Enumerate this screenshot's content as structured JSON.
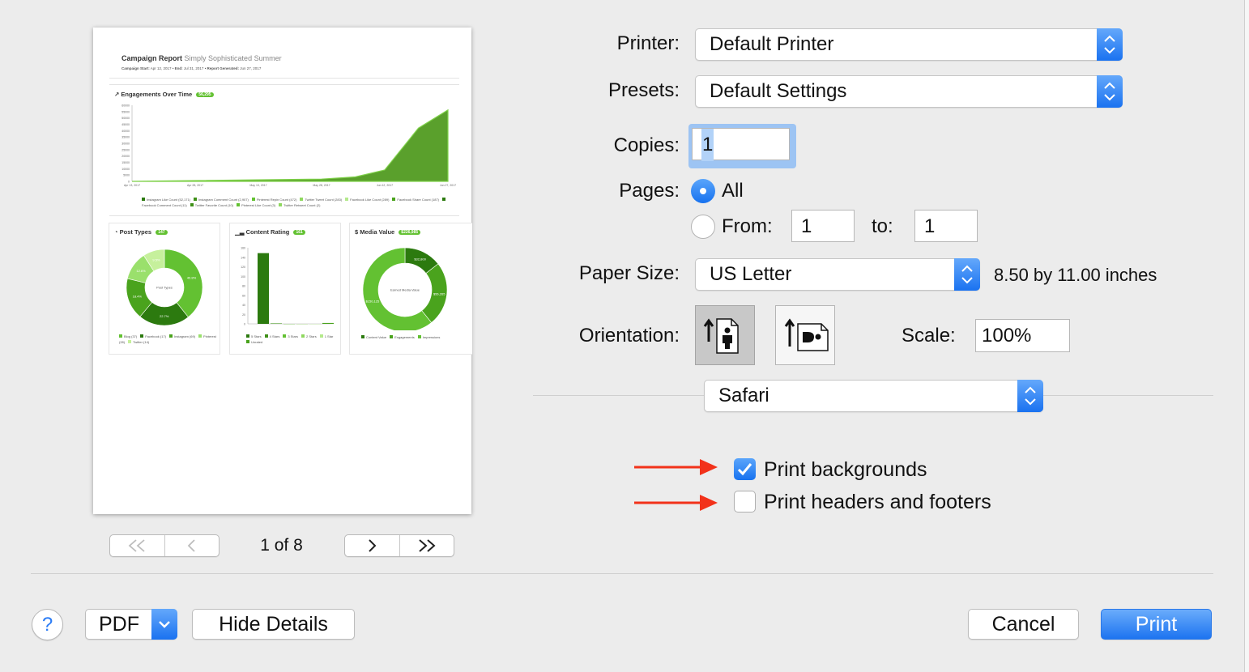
{
  "preview": {
    "report_title": "Campaign Report",
    "report_subtitle": "Simply Sophisticated Summer",
    "meta_start_label": "Campaign Start:",
    "meta_start": "Apr 12, 2017",
    "meta_end_label": "End:",
    "meta_end": "Jul 31, 2017",
    "meta_generated_label": "Report Generated:",
    "meta_generated": "Jun 27, 2017",
    "engagements_title": "Engagements Over Time",
    "engagements_badge": "56,295",
    "engagements_chart": {
      "type": "area",
      "x_ticks": [
        "Apr 13, 2017",
        "Apr 28, 2017",
        "May 13, 2017",
        "May 28, 2017",
        "Jun 12, 2017",
        "Jun 27, 2017"
      ],
      "y_ticks": [
        "60000",
        "55000",
        "50000",
        "45000",
        "40000",
        "35000",
        "30000",
        "25000",
        "20000",
        "15000",
        "10000",
        "5000",
        "0"
      ],
      "x": [
        "Apr 13",
        "May 28",
        "Jun 5",
        "Jun 12",
        "Jun 20",
        "Jun 27"
      ],
      "values": [
        0,
        1800,
        3500,
        9000,
        42000,
        56295
      ],
      "ylim": [
        0,
        60000
      ],
      "color": "#5aa02c",
      "legend": [
        "Instagram Like Count (52,171)",
        "Instagram Comment Count (2,907)",
        "Pinterest Repin Count (472)",
        "Twitter Tweet Count (283)",
        "Facebook Like Count (289)",
        "Facebook Share Count (187)",
        "Facebook Comment Count (11)",
        "Twitter Favorite Count (10)",
        "Pinterest Like Count (3)",
        "Twitter Retweet Count (2)"
      ]
    },
    "post_types": {
      "title": "Post Types",
      "badge": "147",
      "center_label": "Post Types",
      "slice_labels": [
        "40.8%",
        "22.7%",
        "18.4%",
        "12.6%",
        "9.5%"
      ],
      "values": [
        40.8,
        22.7,
        18.4,
        12.6,
        9.5
      ],
      "colors": [
        "#63c132",
        "#2c7a0f",
        "#4aa31d",
        "#9ae06c",
        "#c6f09c"
      ],
      "legend": [
        "Blog (37)",
        "Facebook (17)",
        "Instagram (69)",
        "Pinterest (28)",
        "Twitter (14)"
      ]
    },
    "content_rating": {
      "title": "Content Rating",
      "badge": "161",
      "type": "bar",
      "categories": [
        "5 Stars",
        "4 Stars",
        "3 Stars",
        "2 Stars",
        "1 Star",
        "Unrated"
      ],
      "values": [
        158,
        1,
        0,
        0,
        0,
        2
      ],
      "y_ticks": [
        "160",
        "140",
        "120",
        "100",
        "80",
        "60",
        "40",
        "20",
        "0"
      ],
      "ylim": [
        0,
        170
      ],
      "legend": [
        "5 Stars",
        "4 Stars",
        "3 Stars",
        "2 Stars",
        "1 Star",
        "Unrated"
      ]
    },
    "media_value": {
      "title": "Media Value",
      "badge": "$226,985",
      "center_label": "Earned Media Value",
      "slice_labels": [
        "$32,800",
        "$56,265",
        "$150,125"
      ],
      "values": [
        14.4,
        24.8,
        60.8
      ],
      "colors": [
        "#2c7a0f",
        "#4aa31d",
        "#63c132"
      ],
      "legend": [
        "Content Value",
        "Engagements",
        "Impressions"
      ]
    }
  },
  "pager": {
    "first_icon": "double-chevron-left-icon",
    "prev_icon": "chevron-left-icon",
    "next_icon": "chevron-right-icon",
    "last_icon": "double-chevron-right-icon",
    "indicator": "1 of 8"
  },
  "form": {
    "printer_label": "Printer:",
    "printer_value": "Default Printer",
    "presets_label": "Presets:",
    "presets_value": "Default Settings",
    "copies_label": "Copies:",
    "copies_value": "1",
    "pages_label": "Pages:",
    "pages_all": "All",
    "pages_from": "From:",
    "pages_from_value": "1",
    "pages_to": "to:",
    "pages_to_value": "1",
    "paper_size_label": "Paper Size:",
    "paper_size_value": "US Letter",
    "paper_size_dims": "8.50 by 11.00 inches",
    "orientation_label": "Orientation:",
    "scale_label": "Scale:",
    "scale_value": "100%",
    "section_value": "Safari",
    "print_backgrounds": "Print backgrounds",
    "print_backgrounds_checked": true,
    "print_headers_footers": "Print headers and footers",
    "print_headers_footers_checked": false,
    "accent": "#1a72f0",
    "arrow_color": "#f2321a"
  },
  "footer": {
    "help": "?",
    "pdf": "PDF",
    "hide_details": "Hide Details",
    "cancel": "Cancel",
    "print": "Print"
  }
}
